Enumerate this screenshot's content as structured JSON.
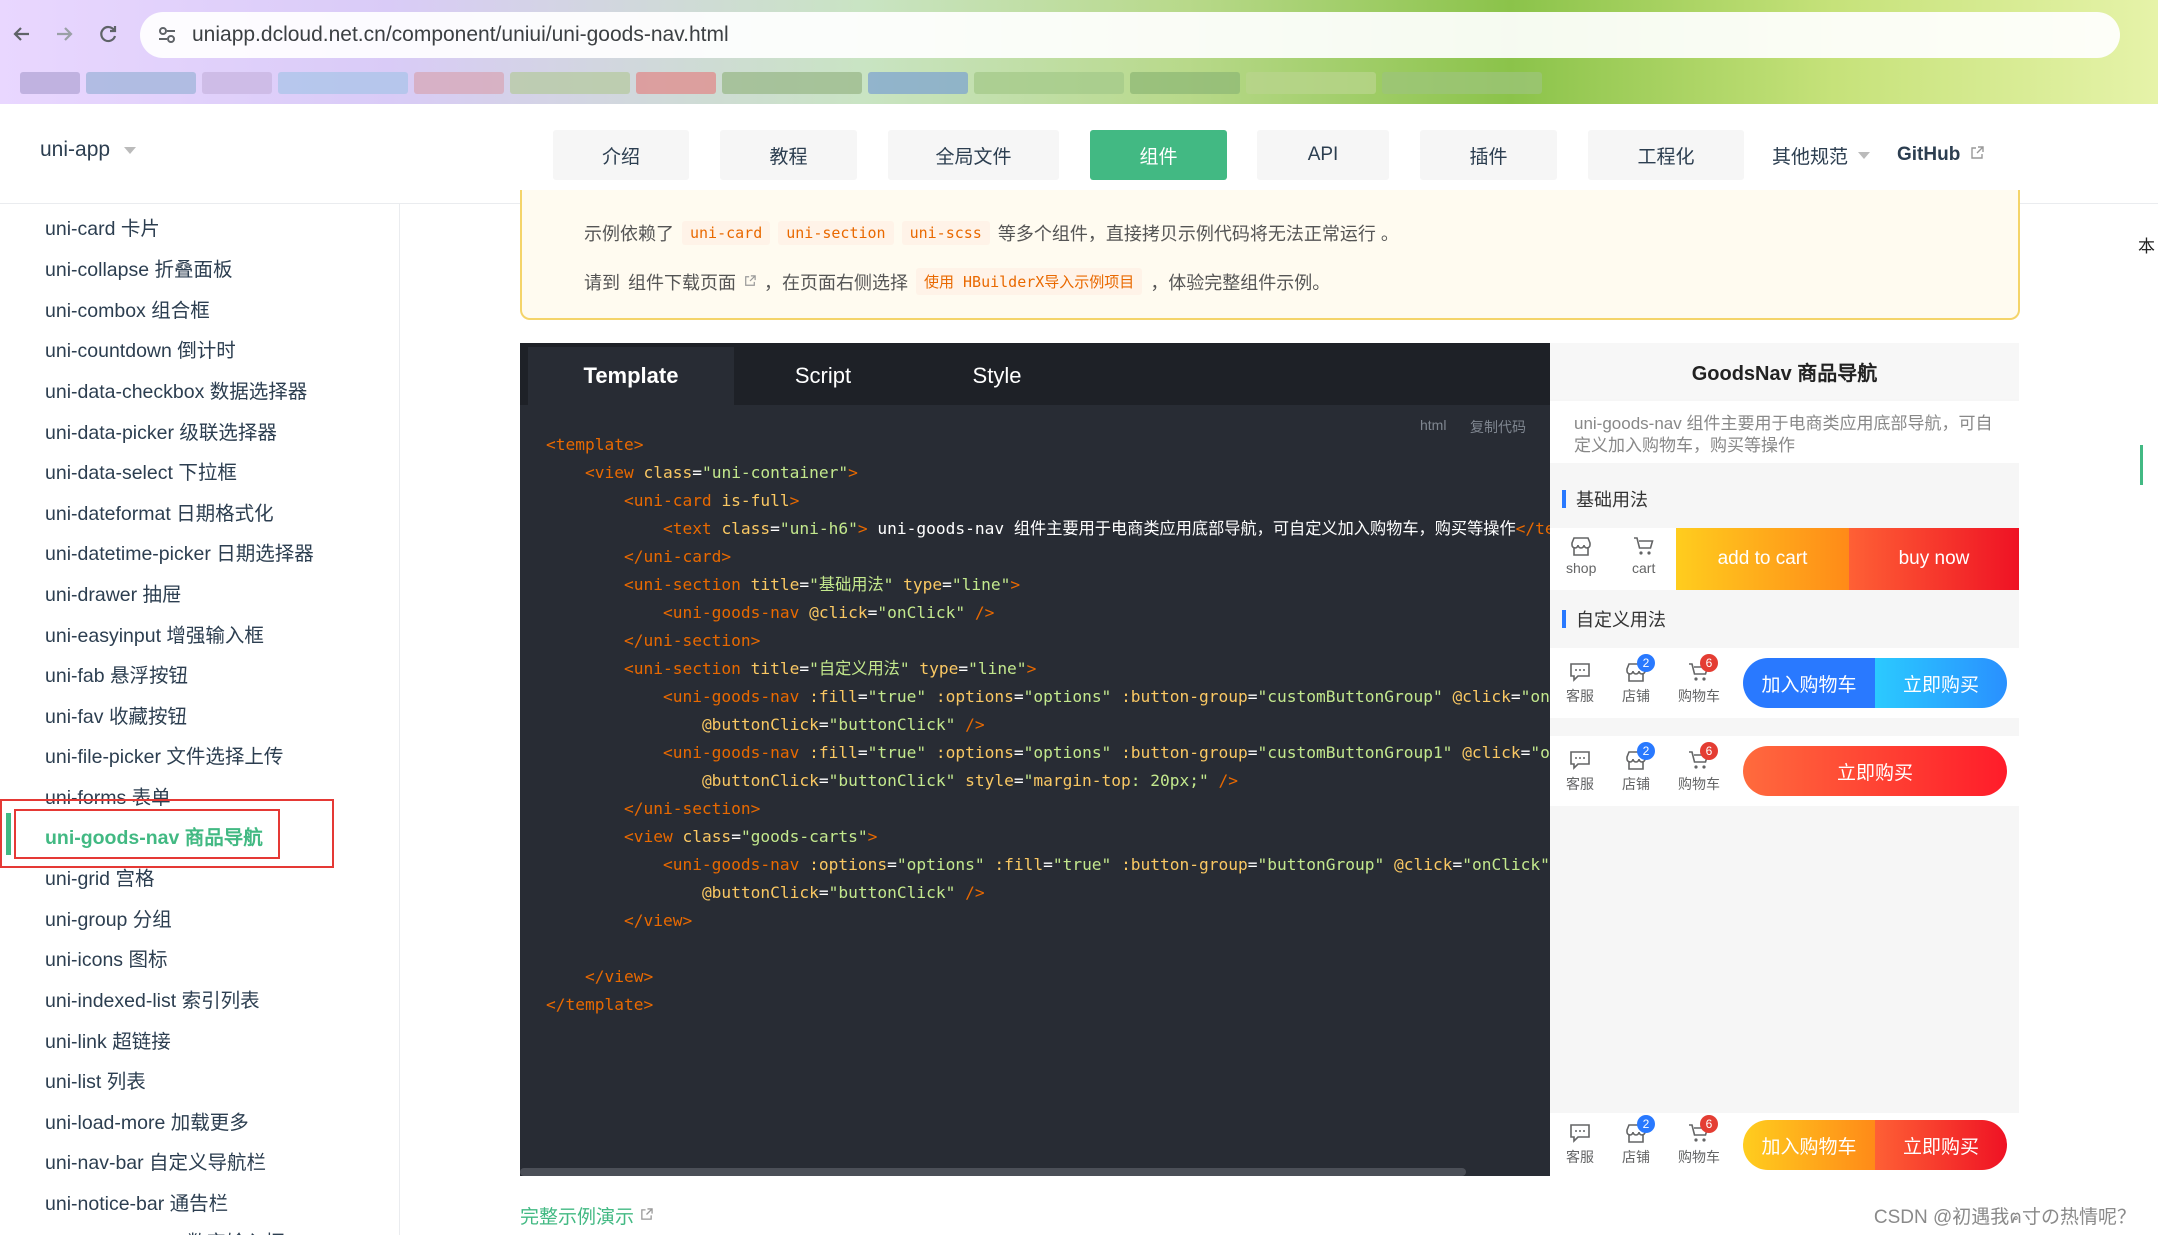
{
  "browser": {
    "url": "uniapp.dcloud.net.cn/component/uniui/uni-goods-nav.html"
  },
  "header": {
    "brand": "uni-app",
    "nav": [
      "介绍",
      "教程",
      "全局文件",
      "组件",
      "API",
      "插件",
      "工程化"
    ],
    "other": "其他规范",
    "github": "GitHub"
  },
  "sidebar": {
    "items": [
      "uni-card 卡片",
      "uni-collapse 折叠面板",
      "uni-combox 组合框",
      "uni-countdown 倒计时",
      "uni-data-checkbox 数据选择器",
      "uni-data-picker 级联选择器",
      "uni-data-select 下拉框",
      "uni-dateformat 日期格式化",
      "uni-datetime-picker 日期选择器",
      "uni-drawer 抽屉",
      "uni-easyinput 增强输入框",
      "uni-fab 悬浮按钮",
      "uni-fav 收藏按钮",
      "uni-file-picker 文件选择上传",
      "uni-forms 表单",
      "uni-goods-nav 商品导航",
      "uni-grid 宫格",
      "uni-group 分组",
      "uni-icons 图标",
      "uni-indexed-list 索引列表",
      "uni-link 超链接",
      "uni-list 列表",
      "uni-load-more 加载更多",
      "uni-nav-bar 自定义导航栏",
      "uni-notice-bar 通告栏",
      "uni-number-box 数字输入框"
    ]
  },
  "tip": {
    "l1_pre": "示例依赖了",
    "chips": [
      "uni-card",
      "uni-section",
      "uni-scss"
    ],
    "l1_post": "等多个组件，直接拷贝示例代码将无法正常运行 。",
    "l2_pre": "请到",
    "l2_link": "组件下载页面",
    "l2_mid": "，在页面右侧选择",
    "l2_chip": "使用 HBuilderX导入示例项目",
    "l2_post": "，体验完整组件示例。"
  },
  "code": {
    "tabs": [
      "Template",
      "Script",
      "Style"
    ],
    "lang": "html",
    "copy": "复制代码"
  },
  "preview": {
    "title": "GoodsNav 商品导航",
    "desc": "uni-goods-nav 组件主要用于电商类应用底部导航，可自定义加入购物车，购买等操作",
    "section_basic": "基础用法",
    "section_custom": "自定义用法",
    "basic_icons": [
      "shop",
      "cart"
    ],
    "basic_buttons": [
      "add to cart",
      "buy now"
    ],
    "custom_icons": [
      "客服",
      "店铺",
      "购物车"
    ],
    "badge_shop": "2",
    "badge_cart": "6",
    "custom_buttons": [
      "加入购物车",
      "立即购买"
    ],
    "single_button": "立即购买",
    "colors": {
      "primary": "#42b983",
      "add_to_cart": "#ffa200",
      "buy_now": "#ff0000",
      "blue_start": "#2979ff",
      "blue_end": "#2bcaff",
      "red": "#ff4444",
      "orange": "#ffa200"
    }
  },
  "footer": {
    "demo_link": "完整示例演示",
    "watermark": "CSDN @初遇我ฅ寸の热情呢？"
  },
  "right_edge": "本"
}
